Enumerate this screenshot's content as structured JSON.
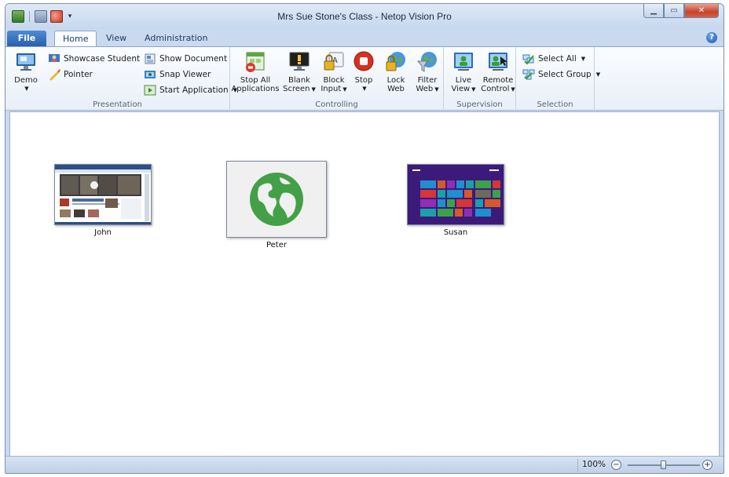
{
  "window": {
    "title": "Mrs Sue Stone's Class - Netop Vision Pro"
  },
  "tabs": [
    {
      "label": "File"
    },
    {
      "label": "Home"
    },
    {
      "label": "View"
    },
    {
      "label": "Administration"
    }
  ],
  "ribbon": {
    "presentation": {
      "label": "Presentation",
      "demo": "Demo",
      "showcase_student": "Showcase Student",
      "pointer": "Pointer",
      "show_document": "Show Document",
      "snap_viewer": "Snap Viewer",
      "start_application": "Start Application"
    },
    "controlling": {
      "label": "Controlling",
      "stop_all_line1": "Stop All",
      "stop_all_line2": "Applications",
      "blank_line1": "Blank",
      "blank_line2": "Screen",
      "block_line1": "Block",
      "block_line2": "Input",
      "stop": "Stop",
      "lock_line1": "Lock",
      "lock_line2": "Web",
      "filter_line1": "Filter",
      "filter_line2": "Web"
    },
    "supervision": {
      "label": "Supervision",
      "live_line1": "Live",
      "live_line2": "View",
      "remote_line1": "Remote",
      "remote_line2": "Control"
    },
    "selection": {
      "label": "Selection",
      "select_all": "Select All",
      "select_group": "Select Group"
    }
  },
  "students": [
    {
      "name": "John"
    },
    {
      "name": "Peter"
    },
    {
      "name": "Susan"
    }
  ],
  "statusbar": {
    "zoom": "100%",
    "zoom_level_fraction": 0.5
  },
  "colors": {
    "accent": "#2a5fab",
    "globe": "#43a047",
    "metro": "#3b1a7a"
  }
}
